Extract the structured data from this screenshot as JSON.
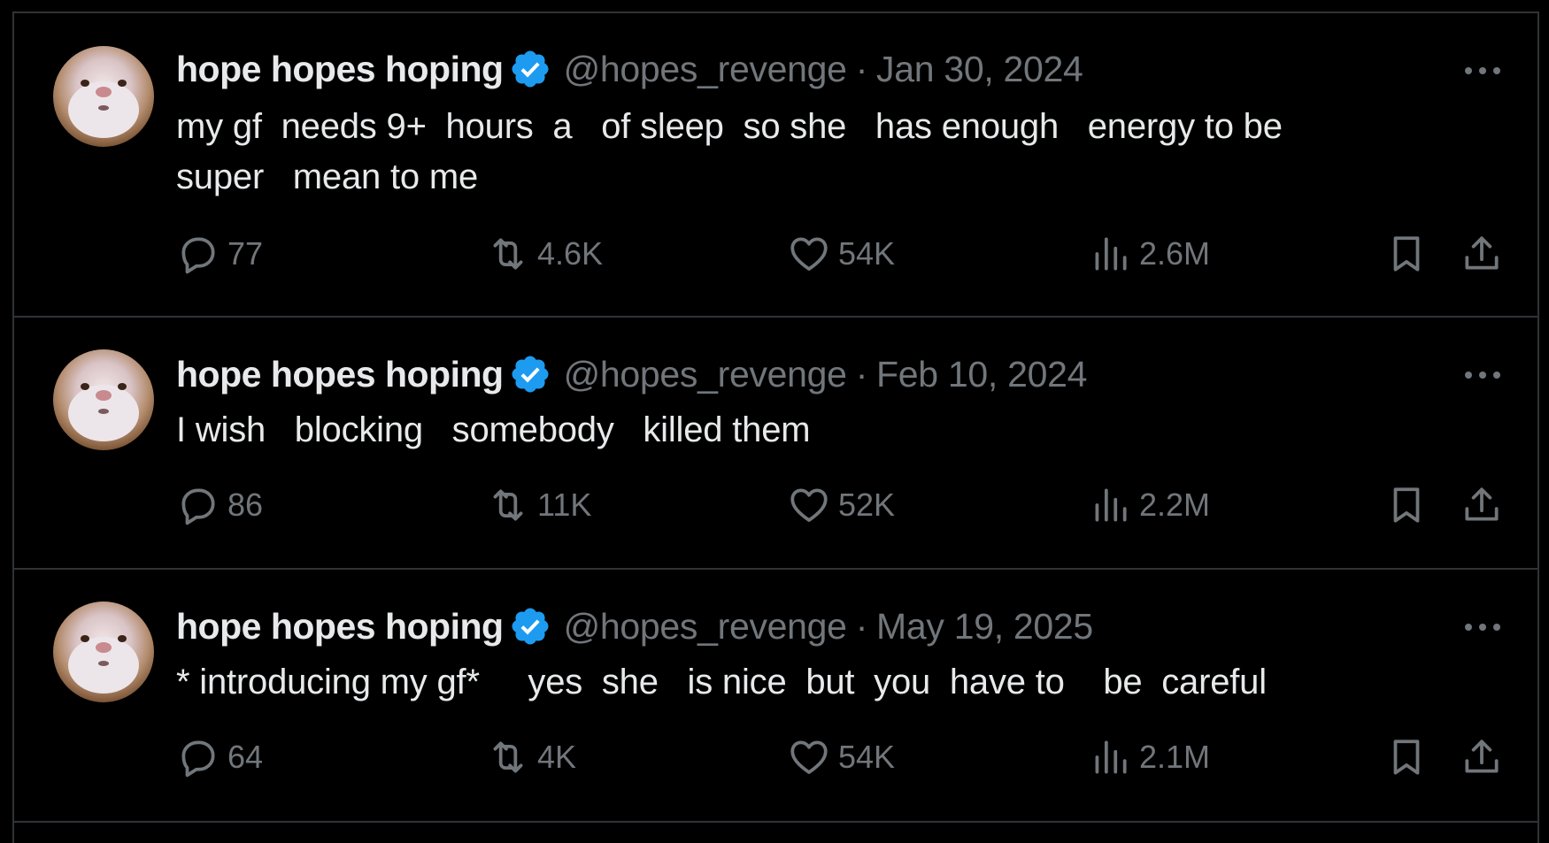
{
  "colors": {
    "background": "#000000",
    "text_primary": "#e7e9ea",
    "text_secondary": "#71767b",
    "divider": "#2f3336",
    "verified": "#1d9bf0"
  },
  "icons": {
    "reply": "reply-icon",
    "retweet": "retweet-icon",
    "like": "heart-icon",
    "views": "views-icon",
    "bookmark": "bookmark-icon",
    "share": "share-icon",
    "more": "more-icon",
    "verified": "verified-badge-icon"
  },
  "tweets": [
    {
      "name": "hope hopes hoping",
      "handle": "@hopes_revenge",
      "separator": "·",
      "date": "Jan 30, 2024",
      "text": "my gf  needs 9+  hours  a   of sleep  so she   has enough   energy to be\nsuper   mean to me",
      "replies": "77",
      "retweets": "4.6K",
      "likes": "54K",
      "views": "2.6M"
    },
    {
      "name": "hope hopes hoping",
      "handle": "@hopes_revenge",
      "separator": "·",
      "date": "Feb 10, 2024",
      "text": "I wish   blocking   somebody   killed them",
      "replies": "86",
      "retweets": "11K",
      "likes": "52K",
      "views": "2.2M"
    },
    {
      "name": "hope hopes hoping",
      "handle": "@hopes_revenge",
      "separator": "·",
      "date": "May 19, 2025",
      "text": "* introducing my gf*     yes  she   is nice  but  you  have to    be  careful",
      "replies": "64",
      "retweets": "4K",
      "likes": "54K",
      "views": "2.1M"
    }
  ]
}
